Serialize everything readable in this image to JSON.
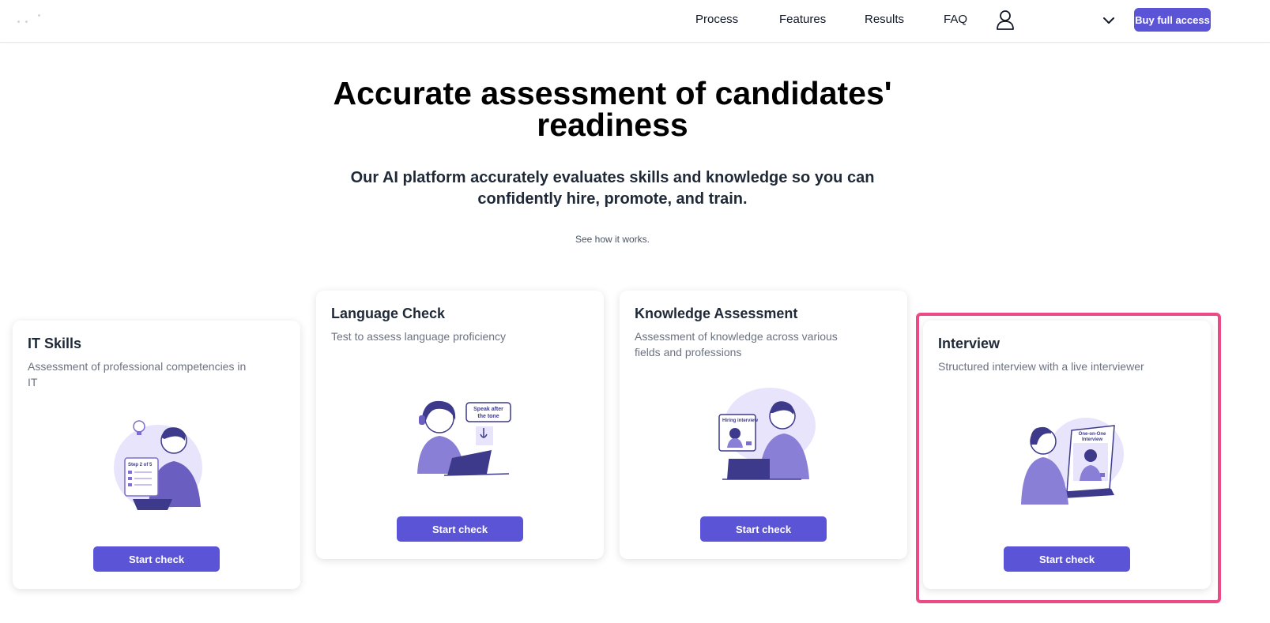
{
  "nav": {
    "links": [
      "Process",
      "Features",
      "Results",
      "FAQ"
    ],
    "user_icon": "user-icon",
    "language_icon": "chevron-down-icon",
    "buy_label": "Buy full access"
  },
  "hero": {
    "title": "Accurate assessment of candidates' readiness",
    "subtitle": "Our AI platform accurately evaluates skills and knowledge so you can confidently hire, promote, and train.",
    "link": "See how it works."
  },
  "cards": [
    {
      "title": "IT Skills",
      "description": "Assessment of professional competencies in IT",
      "illustration_text": "Step 2 of 5",
      "button": "Start check"
    },
    {
      "title": "Language Check",
      "description": "Test to assess language proficiency",
      "illustration_text": "Speak after the tone",
      "button": "Start check"
    },
    {
      "title": "Knowledge Assessment",
      "description": "Assessment of knowledge across various fields and professions",
      "illustration_text": "Hiring interview",
      "button": "Start check"
    },
    {
      "title": "Interview",
      "description": "Structured interview with a live interviewer",
      "illustration_text": "One-on-One Interview",
      "button": "Start check"
    }
  ],
  "colors": {
    "accent": "#5b54d6",
    "highlight": "#ec4a85",
    "illustration": "#7c6fd1",
    "illustration_light": "#e8e4fb"
  }
}
